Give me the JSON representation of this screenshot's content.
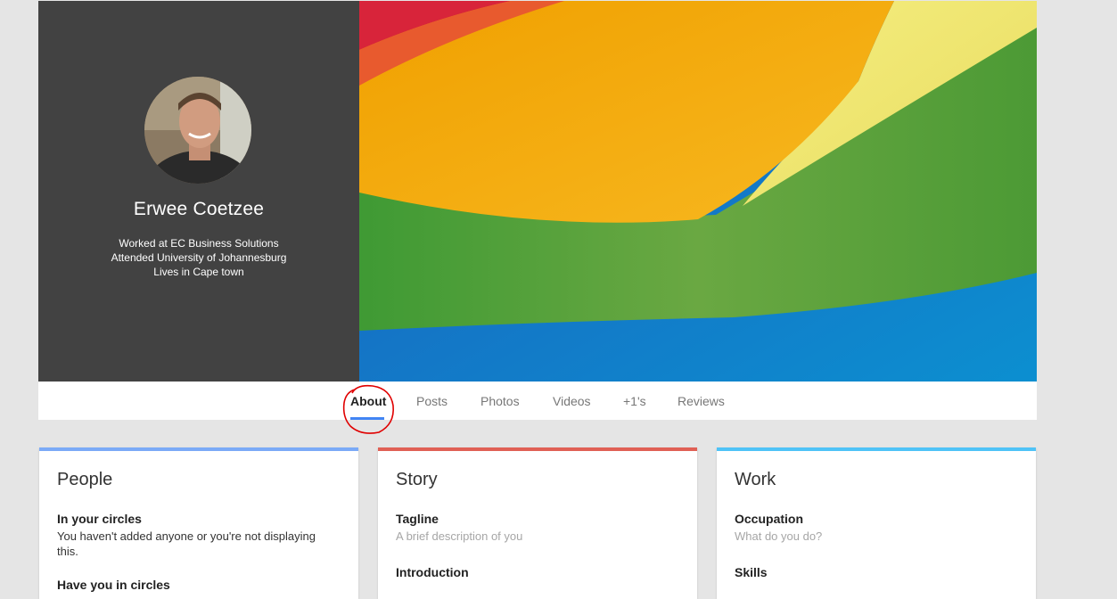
{
  "profile": {
    "name": "Erwee Coetzee",
    "details": [
      "Worked at EC Business Solutions",
      "Attended University of Johannesburg",
      "Lives in Cape town"
    ]
  },
  "tabs": [
    {
      "label": "About",
      "active": true
    },
    {
      "label": "Posts"
    },
    {
      "label": "Photos"
    },
    {
      "label": "Videos"
    },
    {
      "label": "+1's"
    },
    {
      "label": "Reviews"
    }
  ],
  "cards": {
    "people": {
      "title": "People",
      "accent": "#7baaf7",
      "fields": [
        {
          "label": "In your circles",
          "value": "You haven't added anyone or you're not displaying this."
        },
        {
          "label": "Have you in circles",
          "value": ""
        }
      ]
    },
    "story": {
      "title": "Story",
      "accent": "#e06055",
      "fields": [
        {
          "label": "Tagline",
          "value": "A brief description of you"
        },
        {
          "label": "Introduction",
          "value": ""
        }
      ]
    },
    "work": {
      "title": "Work",
      "accent": "#4fc3f7",
      "fields": [
        {
          "label": "Occupation",
          "value": "What do you do?"
        },
        {
          "label": "Skills",
          "value": ""
        }
      ]
    }
  },
  "colors": {
    "profile_panel": "#424242",
    "page_bg": "#e5e5e5",
    "tab_underline": "#4285f4",
    "annotation": "#e00000"
  }
}
